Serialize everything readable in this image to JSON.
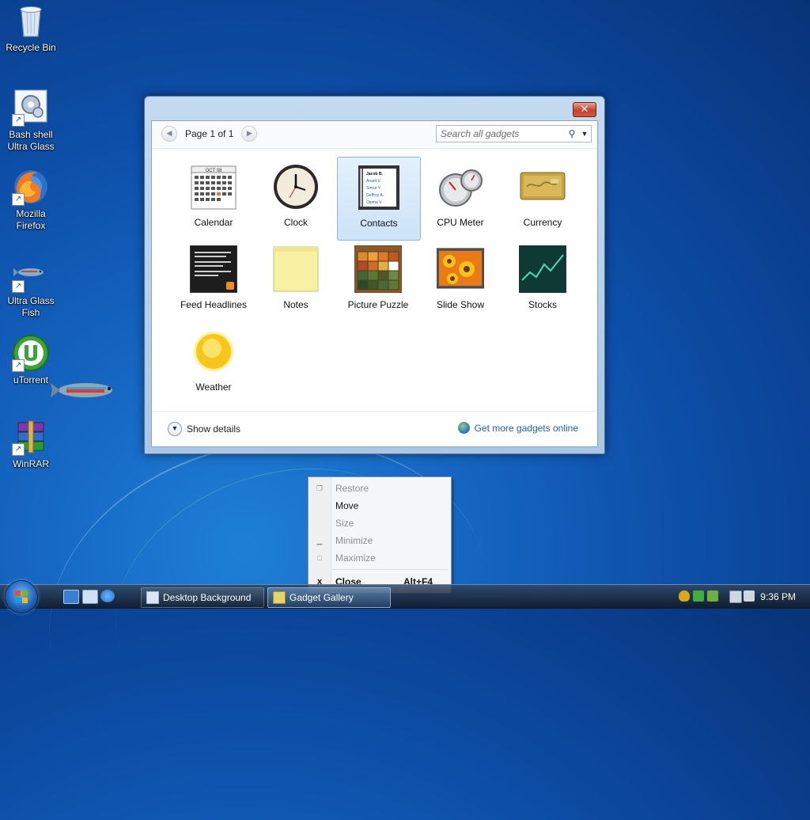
{
  "desktop": {
    "icons": [
      {
        "label_line1": "Recycle Bin",
        "label_line2": ""
      },
      {
        "label_line1": "Bash shell",
        "label_line2": "Ultra Glass"
      },
      {
        "label_line1": "Mozilla",
        "label_line2": "Firefox"
      },
      {
        "label_line1": "Ultra Glass",
        "label_line2": "Fish"
      },
      {
        "label_line1": "uTorrent",
        "label_line2": ""
      },
      {
        "label_line1": "WinRAR",
        "label_line2": ""
      }
    ]
  },
  "gallery": {
    "close_glyph": "✕",
    "page_label": "Page 1 of 1",
    "search_placeholder": "Search all gadgets",
    "selected": "Contacts",
    "gadgets": [
      {
        "label": "Calendar"
      },
      {
        "label": "Clock"
      },
      {
        "label": "Contacts"
      },
      {
        "label": "CPU Meter"
      },
      {
        "label": "Currency"
      },
      {
        "label": "Feed Headlines"
      },
      {
        "label": "Notes"
      },
      {
        "label": "Picture Puzzle"
      },
      {
        "label": "Slide Show"
      },
      {
        "label": "Stocks"
      },
      {
        "label": "Weather"
      }
    ],
    "calendar_month": "OCT 08",
    "contacts_names": [
      "Jacob B.",
      "Anant V.",
      "Smrut Y.",
      "Geffroy A.",
      "Ojoma V."
    ],
    "show_details_label": "Show details",
    "online_label": "Get more gadgets online"
  },
  "context_menu": {
    "items": [
      {
        "label": "Restore",
        "enabled": false,
        "icon": "restore-icon",
        "glyph": "❐"
      },
      {
        "label": "Move",
        "enabled": true,
        "icon": "",
        "glyph": ""
      },
      {
        "label": "Size",
        "enabled": false,
        "icon": "",
        "glyph": ""
      },
      {
        "label": "Minimize",
        "enabled": false,
        "icon": "minimize-icon",
        "glyph": "▁"
      },
      {
        "label": "Maximize",
        "enabled": false,
        "icon": "maximize-icon",
        "glyph": "□"
      },
      {
        "label": "Close",
        "enabled": true,
        "icon": "close-icon",
        "glyph": "x",
        "accelerator": "Alt+F4",
        "bold": true
      }
    ]
  },
  "taskbar": {
    "tasks": [
      {
        "label": "Desktop Background",
        "active": false
      },
      {
        "label": "Gadget Gallery",
        "active": true
      }
    ],
    "clock": "9:36 PM"
  },
  "colors": {
    "link": "#1c5fb5",
    "selection_bg": "#cde3f8",
    "close_button": "#c5432b"
  }
}
